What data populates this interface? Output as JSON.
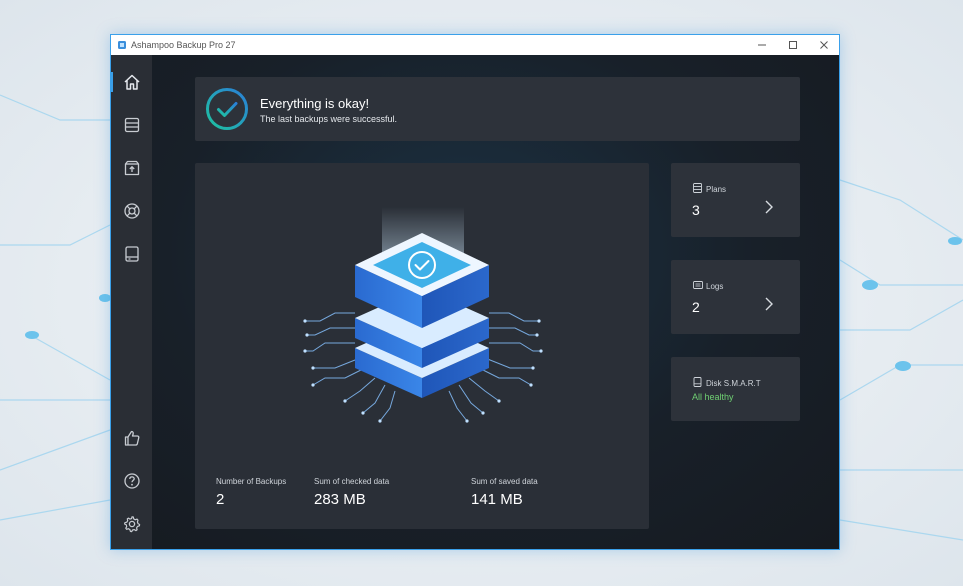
{
  "window": {
    "title": "Ashampoo Backup Pro 27",
    "minimize": "—",
    "maximize": "☐",
    "close": "✕"
  },
  "sidebar": {
    "items": [
      {
        "name": "home",
        "icon": "home-icon",
        "active": true
      },
      {
        "name": "backup-plans",
        "icon": "database-icon"
      },
      {
        "name": "restore",
        "icon": "restore-box-icon"
      },
      {
        "name": "rescue",
        "icon": "lifebuoy-icon"
      },
      {
        "name": "drives",
        "icon": "drive-icon"
      },
      {
        "name": "feedback",
        "icon": "thumbs-up-icon"
      },
      {
        "name": "help",
        "icon": "help-icon"
      },
      {
        "name": "settings",
        "icon": "gear-icon"
      }
    ]
  },
  "status": {
    "title": "Everything is okay!",
    "subtitle": "The last backups were successful."
  },
  "stats": {
    "backups_label": "Number of Backups",
    "backups_value": "2",
    "checked_label": "Sum of checked data",
    "checked_value": "283 MB",
    "saved_label": "Sum of saved data",
    "saved_value": "141 MB"
  },
  "cards": {
    "plans": {
      "label": "Plans",
      "value": "3"
    },
    "logs": {
      "label": "Logs",
      "value": "2"
    },
    "disk": {
      "label": "Disk S.M.A.R.T",
      "value": "All healthy"
    }
  },
  "colors": {
    "accent": "#3aa0ea",
    "success": "#6fcf72",
    "check_gradient_start": "#1ec3a0",
    "check_gradient_end": "#2a7fd8"
  }
}
